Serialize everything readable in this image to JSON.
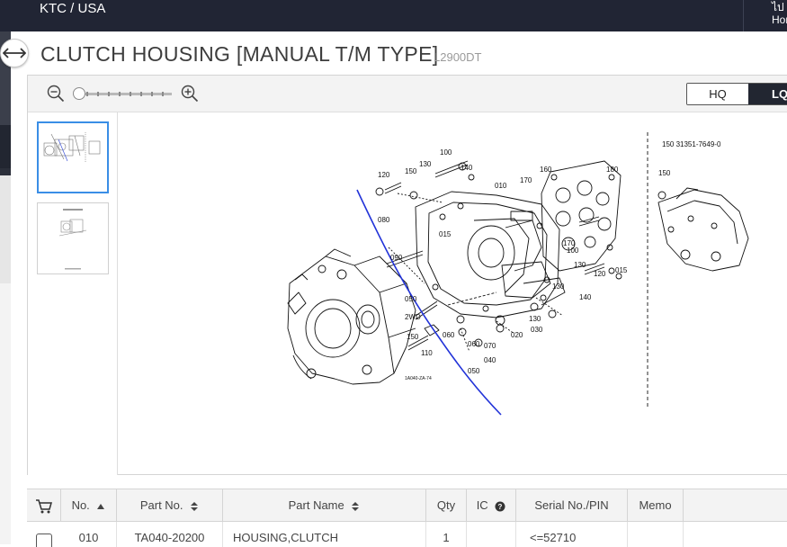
{
  "topbar": {
    "brand": "KTC / USA",
    "right_top": "ไป",
    "right_bottom": "Hor"
  },
  "page": {
    "title": "CLUTCH HOUSING [MANUAL T/M TYPE]",
    "model": "L2900DT"
  },
  "viewer": {
    "quality": {
      "hq_label": "HQ",
      "lq_label": "LQ",
      "selected": "LQ"
    },
    "zoom_level": 0,
    "drawing": {
      "header": "150  31351-7649-0",
      "image_code": "1A040-ZA-74",
      "callouts": [
        "100",
        "130",
        "140",
        "120",
        "150",
        "010",
        "170",
        "160",
        "180",
        "080",
        "015",
        "090",
        "170",
        "100",
        "130",
        "120",
        "015",
        "050",
        "130",
        "140",
        "2WD",
        "150",
        "060",
        "130",
        "070",
        "020",
        "030",
        "110",
        "060",
        "040",
        "050",
        "150"
      ]
    }
  },
  "table": {
    "headers": {
      "no": "No.",
      "part_no": "Part No.",
      "part_name": "Part Name",
      "qty": "Qty",
      "ic": "IC",
      "serial": "Serial No./PIN",
      "memo": "Memo"
    },
    "rows": [
      {
        "no": "010",
        "part_no": "TA040-20200",
        "part_name": "HOUSING,CLUTCH",
        "qty": "1",
        "ic": "",
        "serial": "<=52710",
        "memo": ""
      }
    ]
  }
}
